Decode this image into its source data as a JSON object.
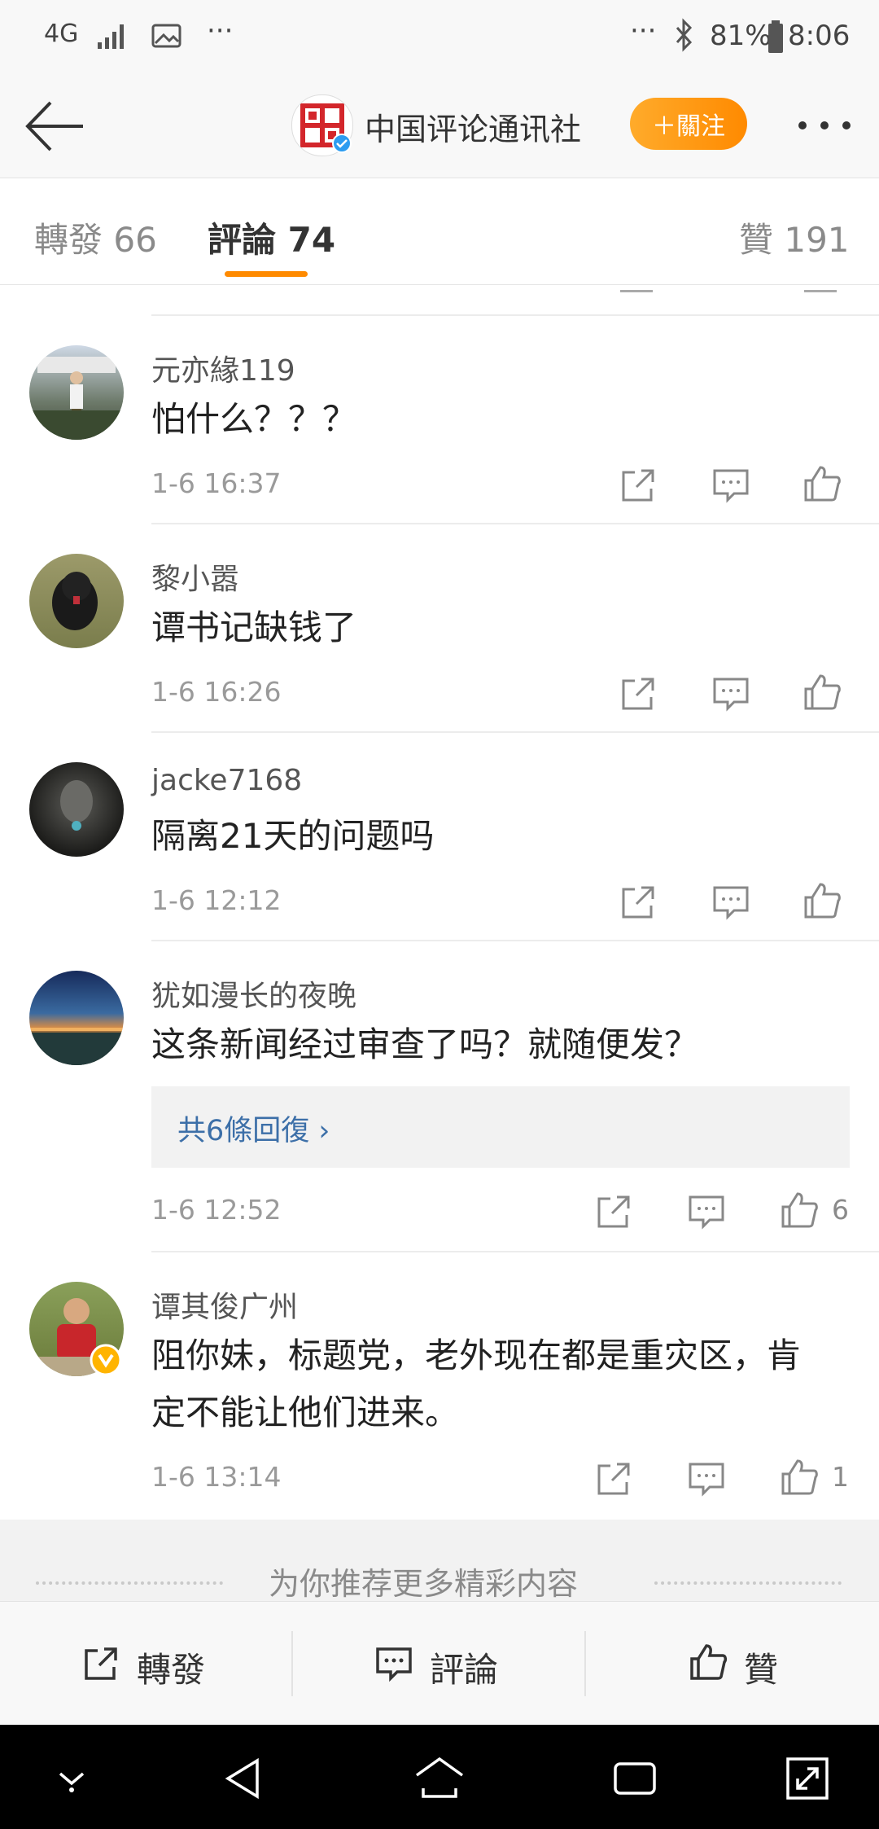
{
  "status_bar": {
    "network": "4G",
    "more": "···",
    "more_right": "···",
    "battery": "81%",
    "time": "8:06"
  },
  "header": {
    "account_name": "中国评论通讯社",
    "follow_label": "＋關注",
    "more_icon": "ellipsis-icon"
  },
  "tabs": [
    {
      "label": "轉發 66"
    },
    {
      "label": "評論 74",
      "active": true
    },
    {
      "label": "贊 191"
    }
  ],
  "comments": [
    {
      "user": "元亦緣119",
      "text": "怕什么？？？",
      "time": "1-6 16:37",
      "likes": ""
    },
    {
      "user": "黎小嚣",
      "text": "谭书记缺钱了",
      "time": "1-6 16:26",
      "likes": ""
    },
    {
      "user": "jacke7168",
      "text": "隔离21天的问题吗",
      "time": "1-6 12:12",
      "likes": ""
    },
    {
      "user": "犹如漫长的夜晚",
      "text": "这条新闻经过审查了吗？就随便发？",
      "time": "1-6 12:52",
      "likes": "6",
      "replies": "共6條回復 ›"
    },
    {
      "user": "谭其俊广州",
      "text_line1": "阻你妹，标题党，老外现在都是重灾区，肯",
      "text_line2": "定不能让他们进来。",
      "time": "1-6 13:14",
      "likes": "1"
    }
  ],
  "recommend": {
    "label": "为你推荐更多精彩内容"
  },
  "toolbar": {
    "repost_label": "轉發",
    "comment_label": "評論",
    "like_label": "贊"
  },
  "colors": {
    "accent": "#ff8a00",
    "link": "#3c6fa8",
    "verified": "#ffb400"
  }
}
